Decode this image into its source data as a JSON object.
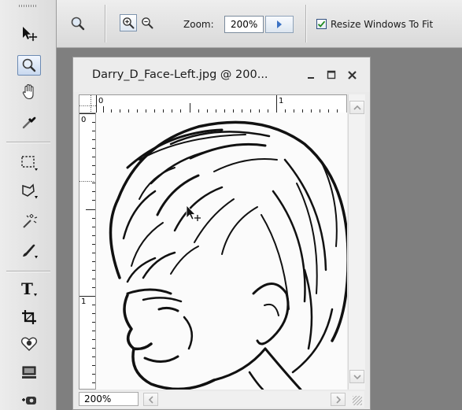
{
  "options_bar": {
    "zoom_label": "Zoom:",
    "zoom_value": "200%",
    "resize_label": "Resize Windows To Fit",
    "resize_checked": true
  },
  "tools": {
    "icons": [
      "move-tool-icon",
      "zoom-tool-icon",
      "hand-tool-icon",
      "eyedropper-tool-icon",
      "marquee-tool-icon",
      "lasso-tool-icon",
      "magic-wand-tool-icon",
      "brush-tool-icon",
      "type-tool-icon",
      "crop-tool-icon",
      "shape-tool-icon",
      "screen-mode-icon",
      "camera-tool-icon"
    ],
    "active": "zoom-tool-icon"
  },
  "document": {
    "title": "Darry_D_Face-Left.jpg @ 200...",
    "zoom_status": "200%",
    "ruler_top": [
      "0",
      "1"
    ],
    "ruler_left": [
      "0",
      "1"
    ]
  }
}
